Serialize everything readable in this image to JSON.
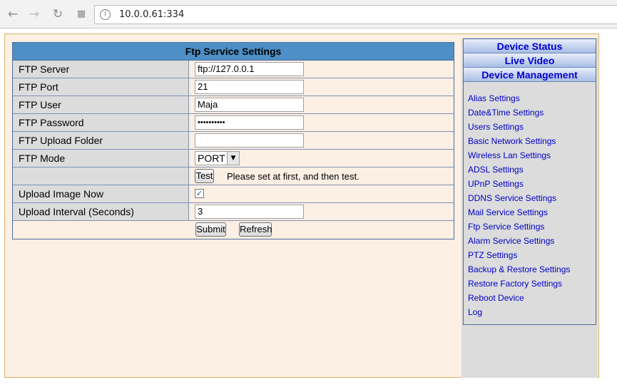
{
  "browser": {
    "url": "10.0.0.61:334"
  },
  "ftp": {
    "title": "Ftp Service Settings",
    "server_label": "FTP Server",
    "server_value": "ftp://127.0.0.1",
    "port_label": "FTP Port",
    "port_value": "21",
    "user_label": "FTP User",
    "user_value": "Maja",
    "password_label": "FTP Password",
    "password_value": "••••••••••",
    "folder_label": "FTP Upload Folder",
    "folder_value": "",
    "mode_label": "FTP Mode",
    "mode_value": "PORT",
    "test_label": "Test",
    "test_hint": "Please set at first, and then test.",
    "upload_now_label": "Upload Image Now",
    "upload_now_checked": true,
    "interval_label": "Upload Interval (Seconds)",
    "interval_value": "3",
    "submit_label": "Submit",
    "refresh_label": "Refresh"
  },
  "nav": {
    "device_status": "Device Status",
    "live_video": "Live Video",
    "device_management": "Device Management",
    "links": [
      "Alias Settings",
      "Date&Time Settings",
      "Users Settings",
      "Basic Network Settings",
      "Wireless Lan Settings",
      "ADSL Settings",
      "UPnP Settings",
      "DDNS Service Settings",
      "Mail Service Settings",
      "Ftp Service Settings",
      "Alarm Service Settings",
      "PTZ Settings",
      "Backup & Restore Settings",
      "Restore Factory Settings",
      "Reboot Device",
      "Log"
    ]
  }
}
